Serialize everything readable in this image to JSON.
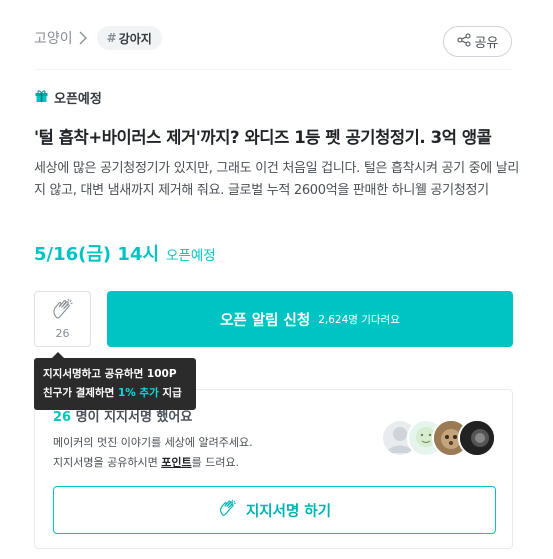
{
  "breadcrumb": {
    "category": "고양이",
    "tag_hash": "#",
    "tag": "강아지"
  },
  "share": {
    "label": "공유"
  },
  "status": {
    "label": "오픈예정"
  },
  "project": {
    "title": "'털 흡착+바이러스 제거'까지? 와디즈 1등 펫 공기청정기. 3억 앵콜",
    "description": "세상에 많은 공기청정기가 있지만, 그래도 이건 처음일 겁니다. 털은 흡착시켜 공기 중에 날리지 않고, 대변 냄새까지 제거해 줘요. 글로벌 누적 2600억을 판매한 하니웰 공기청정기",
    "open_date": "5/16(금) 14시",
    "open_label": "오픈예정"
  },
  "support": {
    "count": "26"
  },
  "notify": {
    "label": "오픈 알림 신청",
    "waiting": "2,624명 기다려요"
  },
  "tooltip": {
    "line1": "지지서명하고 공유하면 100P",
    "line2_prefix": "친구가 결제하면 ",
    "line2_accent": "1% 추가",
    "line2_suffix": " 지급"
  },
  "signature_card": {
    "count": "26",
    "heading_suffix": " 명이 지지서명 했어요",
    "line1": "메이커의 멋진 이야기를 세상에 알려주세요.",
    "line2_prefix": "지지서명을 공유하시면 ",
    "line2_point": "포인트",
    "line2_suffix": "를 드려요.",
    "button_label": "지지서명 하기"
  },
  "colors": {
    "accent": "#00c4c4",
    "tooltip_bg": "#2b2b2b"
  },
  "icons": [
    "chevron-right-icon",
    "share-icon",
    "gift-icon",
    "clap-icon",
    "clap-icon"
  ]
}
